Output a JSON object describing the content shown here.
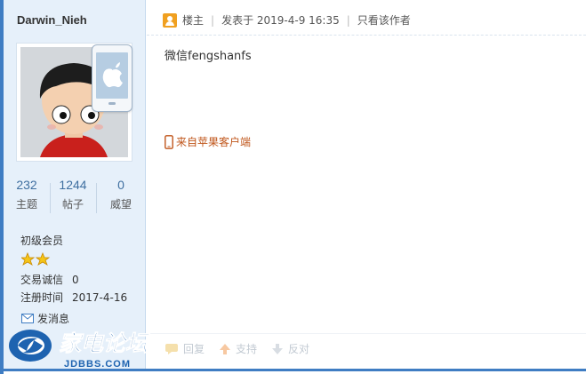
{
  "user": {
    "name": "Darwin_Nieh",
    "level": "初级会员",
    "trade_label": "交易诚信",
    "trade_value": "0",
    "register_label": "注册时间",
    "register_value": "2017-4-16",
    "send_message": "发消息"
  },
  "stats": [
    {
      "value": "232",
      "label": "主题"
    },
    {
      "value": "1244",
      "label": "帖子"
    },
    {
      "value": "0",
      "label": "威望"
    }
  ],
  "post": {
    "host_label": "楼主",
    "posted_at": "发表于 2019-4-9 16:35",
    "only_author": "只看该作者",
    "content": "微信fengshanfs",
    "from_client": "来自苹果客户端"
  },
  "actions": {
    "reply": "回复",
    "support": "支持",
    "oppose": "反对"
  },
  "logo": {
    "name": "家电论坛",
    "domain": "JDBBS.COM"
  },
  "colors": {
    "border": "#3f7dc3",
    "sidebar_bg": "#e6f0fa",
    "link_orange": "#c0561b",
    "stat_blue": "#3f6fa0"
  }
}
